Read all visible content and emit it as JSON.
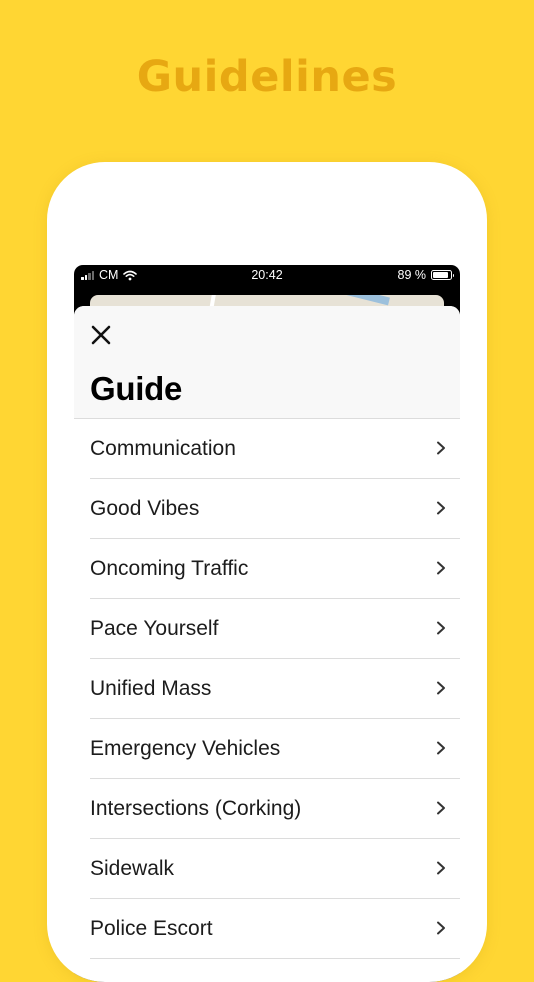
{
  "headline": "Guidelines",
  "status_bar": {
    "carrier": "CM",
    "time": "20:42",
    "battery": "89 %"
  },
  "sheet": {
    "title": "Guide",
    "items": [
      {
        "label": "Communication"
      },
      {
        "label": "Good Vibes"
      },
      {
        "label": "Oncoming Traffic"
      },
      {
        "label": "Pace Yourself"
      },
      {
        "label": "Unified Mass"
      },
      {
        "label": "Emergency Vehicles"
      },
      {
        "label": "Intersections (Corking)"
      },
      {
        "label": "Sidewalk"
      },
      {
        "label": "Police Escort"
      }
    ]
  },
  "icons": {
    "close": "close-icon",
    "chevron": "chevron-right-icon",
    "wifi": "wifi-icon",
    "signal": "cellular-signal-icon",
    "battery": "battery-icon"
  },
  "colors": {
    "background": "#FFD633",
    "headline": "#E7A812",
    "sheet_header": "#F8F8F8",
    "divider": "#DCDCDC"
  }
}
